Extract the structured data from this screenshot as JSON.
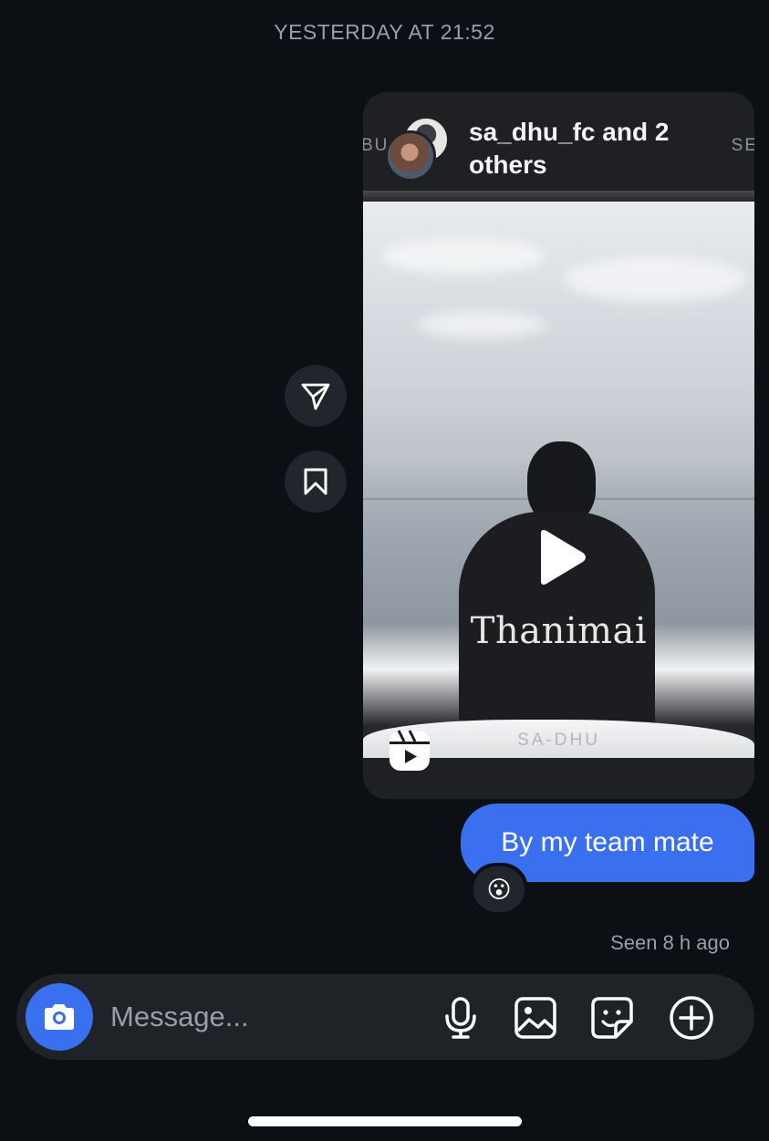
{
  "timestamp": "YESTERDAY AT 21:52",
  "shared_reel": {
    "owner": "sa_dhu_fc and 2 others",
    "edge_text_left": "BU",
    "edge_text_right": "SE",
    "caption": "Thanimai",
    "footer_text": "SA-DHU"
  },
  "side_actions": {
    "share_icon": "paper-plane-icon",
    "save_icon": "bookmark-icon"
  },
  "message": {
    "text": "By my team mate",
    "reaction": "😮"
  },
  "seen_status": "Seen 8 h ago",
  "composer": {
    "placeholder": "Message...",
    "icons": [
      "camera-icon",
      "microphone-icon",
      "gallery-icon",
      "sticker-icon",
      "plus-icon"
    ]
  },
  "colors": {
    "background": "#0c0f14",
    "accent": "#3a6ff0",
    "surface": "#1f2227"
  }
}
